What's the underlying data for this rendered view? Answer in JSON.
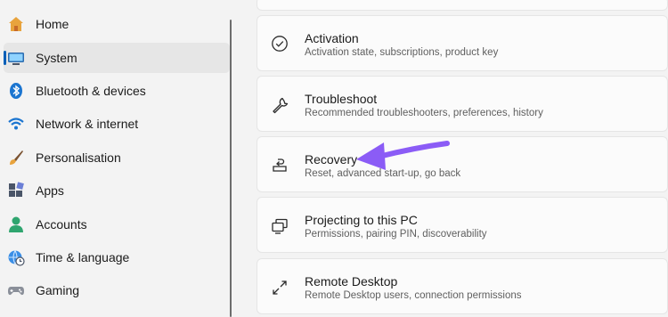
{
  "sidebar": {
    "items": [
      {
        "label": "Home",
        "icon": "home-icon"
      },
      {
        "label": "System",
        "icon": "system-icon",
        "selected": true
      },
      {
        "label": "Bluetooth & devices",
        "icon": "bluetooth-icon"
      },
      {
        "label": "Network & internet",
        "icon": "wifi-icon"
      },
      {
        "label": "Personalisation",
        "icon": "brush-icon"
      },
      {
        "label": "Apps",
        "icon": "apps-icon"
      },
      {
        "label": "Accounts",
        "icon": "account-icon"
      },
      {
        "label": "Time & language",
        "icon": "globe-clock-icon"
      },
      {
        "label": "Gaming",
        "icon": "gamepad-icon"
      }
    ]
  },
  "settings": [
    {
      "title": "Activation",
      "subtitle": "Activation state, subscriptions, product key",
      "icon": "check-circle-icon"
    },
    {
      "title": "Troubleshoot",
      "subtitle": "Recommended troubleshooters, preferences, history",
      "icon": "wrench-icon"
    },
    {
      "title": "Recovery",
      "subtitle": "Reset, advanced start-up, go back",
      "icon": "recovery-icon"
    },
    {
      "title": "Projecting to this PC",
      "subtitle": "Permissions, pairing PIN, discoverability",
      "icon": "projecting-icon"
    },
    {
      "title": "Remote Desktop",
      "subtitle": "Remote Desktop users, connection permissions",
      "icon": "remote-desktop-icon"
    }
  ],
  "colors": {
    "accent": "#005fb8",
    "annotation_arrow": "#8b5cf6"
  }
}
